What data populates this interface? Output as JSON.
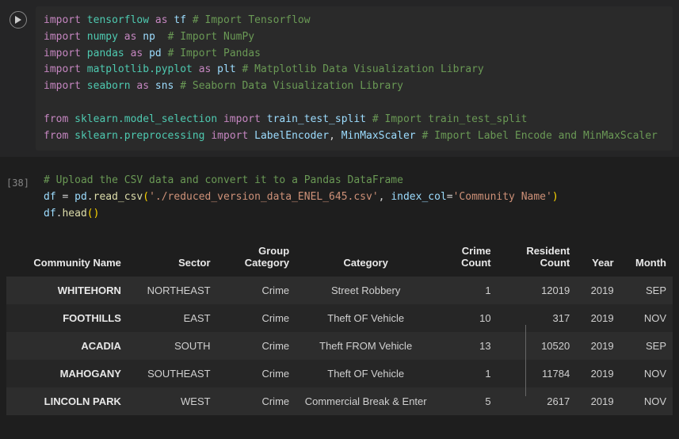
{
  "cell1": {
    "lines": [
      [
        [
          "kw",
          "import"
        ],
        [
          "op",
          " "
        ],
        [
          "mod",
          "tensorflow"
        ],
        [
          "op",
          " "
        ],
        [
          "kw",
          "as"
        ],
        [
          "op",
          " "
        ],
        [
          "alias",
          "tf"
        ],
        [
          "op",
          " "
        ],
        [
          "cmt",
          "# Import Tensorflow"
        ]
      ],
      [
        [
          "kw",
          "import"
        ],
        [
          "op",
          " "
        ],
        [
          "mod",
          "numpy"
        ],
        [
          "op",
          " "
        ],
        [
          "kw",
          "as"
        ],
        [
          "op",
          " "
        ],
        [
          "alias",
          "np"
        ],
        [
          "op",
          "  "
        ],
        [
          "cmt",
          "# Import NumPy"
        ]
      ],
      [
        [
          "kw",
          "import"
        ],
        [
          "op",
          " "
        ],
        [
          "mod",
          "pandas"
        ],
        [
          "op",
          " "
        ],
        [
          "kw",
          "as"
        ],
        [
          "op",
          " "
        ],
        [
          "alias",
          "pd"
        ],
        [
          "op",
          " "
        ],
        [
          "cmt",
          "# Import Pandas"
        ]
      ],
      [
        [
          "kw",
          "import"
        ],
        [
          "op",
          " "
        ],
        [
          "mod",
          "matplotlib.pyplot"
        ],
        [
          "op",
          " "
        ],
        [
          "kw",
          "as"
        ],
        [
          "op",
          " "
        ],
        [
          "alias",
          "plt"
        ],
        [
          "op",
          " "
        ],
        [
          "cmt",
          "# Matplotlib Data Visualization Library"
        ]
      ],
      [
        [
          "kw",
          "import"
        ],
        [
          "op",
          " "
        ],
        [
          "mod",
          "seaborn"
        ],
        [
          "op",
          " "
        ],
        [
          "kw",
          "as"
        ],
        [
          "op",
          " "
        ],
        [
          "alias",
          "sns"
        ],
        [
          "op",
          " "
        ],
        [
          "cmt",
          "# Seaborn Data Visualization Library"
        ]
      ],
      [],
      [
        [
          "kw",
          "from"
        ],
        [
          "op",
          " "
        ],
        [
          "mod",
          "sklearn.model_selection"
        ],
        [
          "op",
          " "
        ],
        [
          "kw",
          "import"
        ],
        [
          "op",
          " "
        ],
        [
          "var",
          "train_test_split"
        ],
        [
          "op",
          " "
        ],
        [
          "cmt",
          "# Import train_test_split"
        ]
      ],
      [
        [
          "kw",
          "from"
        ],
        [
          "op",
          " "
        ],
        [
          "mod",
          "sklearn.preprocessing"
        ],
        [
          "op",
          " "
        ],
        [
          "kw",
          "import"
        ],
        [
          "op",
          " "
        ],
        [
          "var",
          "LabelEncoder"
        ],
        [
          "op",
          ", "
        ],
        [
          "var",
          "MinMaxScaler"
        ],
        [
          "op",
          " "
        ],
        [
          "cmt",
          "# Import Label Encode and MinMaxScaler"
        ]
      ]
    ]
  },
  "cell2": {
    "prompt": "[38]",
    "lines": [
      [
        [
          "cmt",
          "# Upload the CSV data and convert it to a Pandas DataFrame"
        ]
      ],
      [
        [
          "var",
          "df"
        ],
        [
          "op",
          " = "
        ],
        [
          "var",
          "pd"
        ],
        [
          "op",
          "."
        ],
        [
          "fn",
          "read_csv"
        ],
        [
          "paren",
          "("
        ],
        [
          "str",
          "'./reduced_version_data_ENEL_645.csv'"
        ],
        [
          "op",
          ", "
        ],
        [
          "var",
          "index_col"
        ],
        [
          "op",
          "="
        ],
        [
          "str",
          "'Community Name'"
        ],
        [
          "paren",
          ")"
        ]
      ],
      [
        [
          "var",
          "df"
        ],
        [
          "op",
          "."
        ],
        [
          "fn",
          "head"
        ],
        [
          "paren",
          "()"
        ]
      ]
    ]
  },
  "table": {
    "index_name": "Community Name",
    "columns": [
      "Sector",
      "Group Category",
      "Category",
      "Crime Count",
      "Resident Count",
      "Year",
      "Month"
    ],
    "rows": [
      {
        "idx": "WHITEHORN",
        "Sector": "NORTHEAST",
        "Group Category": "Crime",
        "Category": "Street Robbery",
        "Crime Count": "1",
        "Resident Count": "12019",
        "Year": "2019",
        "Month": "SEP"
      },
      {
        "idx": "FOOTHILLS",
        "Sector": "EAST",
        "Group Category": "Crime",
        "Category": "Theft OF Vehicle",
        "Crime Count": "10",
        "Resident Count": "317",
        "Year": "2019",
        "Month": "NOV"
      },
      {
        "idx": "ACADIA",
        "Sector": "SOUTH",
        "Group Category": "Crime",
        "Category": "Theft FROM Vehicle",
        "Crime Count": "13",
        "Resident Count": "10520",
        "Year": "2019",
        "Month": "SEP"
      },
      {
        "idx": "MAHOGANY",
        "Sector": "SOUTHEAST",
        "Group Category": "Crime",
        "Category": "Theft OF Vehicle",
        "Crime Count": "1",
        "Resident Count": "11784",
        "Year": "2019",
        "Month": "NOV"
      },
      {
        "idx": "LINCOLN PARK",
        "Sector": "WEST",
        "Group Category": "Crime",
        "Category": "Commercial Break & Enter",
        "Crime Count": "5",
        "Resident Count": "2617",
        "Year": "2019",
        "Month": "NOV"
      }
    ]
  }
}
